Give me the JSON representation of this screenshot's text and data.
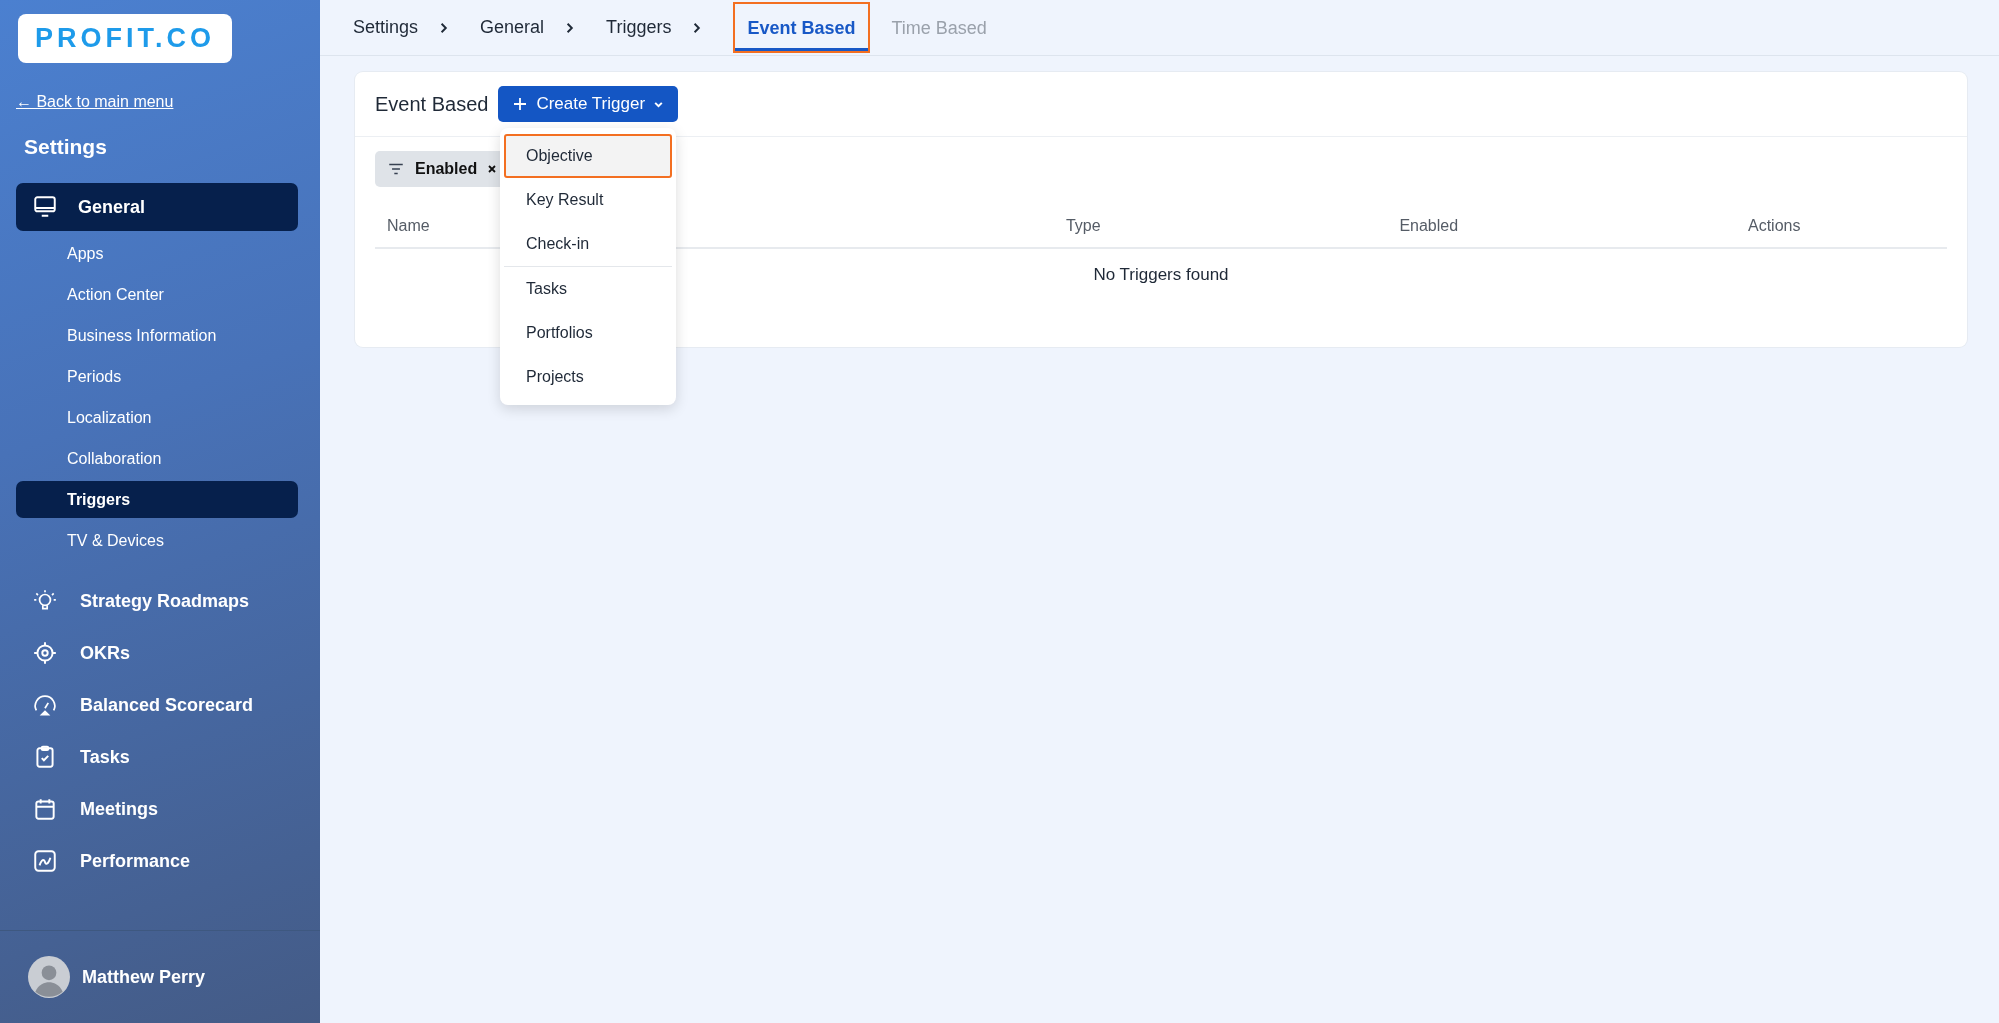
{
  "sidebar": {
    "logo": "PROFIT.CO",
    "back_link": "← Back to main menu",
    "heading": "Settings",
    "section": {
      "label": "General",
      "selected": true,
      "children": [
        {
          "label": "Apps",
          "selected": false
        },
        {
          "label": "Action Center",
          "selected": false
        },
        {
          "label": "Business Information",
          "selected": false
        },
        {
          "label": "Periods",
          "selected": false
        },
        {
          "label": "Localization",
          "selected": false
        },
        {
          "label": "Collaboration",
          "selected": false
        },
        {
          "label": "Triggers",
          "selected": true
        },
        {
          "label": "TV & Devices",
          "selected": false
        }
      ]
    },
    "modules": [
      {
        "label": "Strategy Roadmaps",
        "kind": "bulb"
      },
      {
        "label": "OKRs",
        "kind": "target"
      },
      {
        "label": "Balanced Scorecard",
        "kind": "gauge"
      },
      {
        "label": "Tasks",
        "kind": "clipboard"
      },
      {
        "label": "Meetings",
        "kind": "calendar"
      },
      {
        "label": "Performance",
        "kind": "chart"
      }
    ],
    "user": {
      "name": "Matthew Perry"
    }
  },
  "breadcrumb": [
    "Settings",
    "General",
    "Triggers"
  ],
  "tabs": [
    {
      "label": "Event Based",
      "selected": true,
      "highlighted": true
    },
    {
      "label": "Time Based",
      "selected": false,
      "highlighted": false
    }
  ],
  "card": {
    "title": "Event Based",
    "create_button": "Create Trigger",
    "filter_chip": "Enabled",
    "table": {
      "columns": [
        "Name",
        "Type",
        "Enabled",
        "Actions"
      ],
      "empty_message": "No Triggers found"
    }
  },
  "dropdown": {
    "groups": [
      [
        {
          "label": "Objective",
          "highlighted": true
        },
        {
          "label": "Key Result",
          "highlighted": false
        },
        {
          "label": "Check-in",
          "highlighted": false
        }
      ],
      [
        {
          "label": "Tasks",
          "highlighted": false
        },
        {
          "label": "Portfolios",
          "highlighted": false
        },
        {
          "label": "Projects",
          "highlighted": false
        }
      ]
    ]
  }
}
